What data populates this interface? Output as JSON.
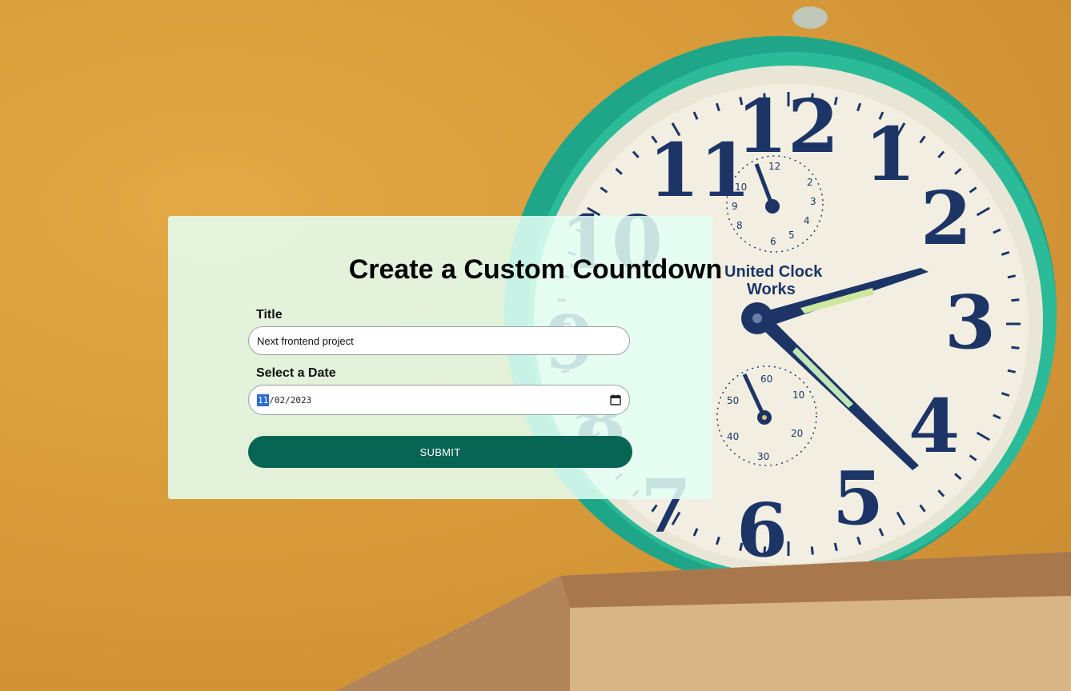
{
  "form": {
    "heading": "Create a Custom Countdown",
    "title_label": "Title",
    "title_value": "Next frontend project",
    "date_label": "Select a Date",
    "date_month": "11",
    "date_rest": "/02/2023",
    "date_icon": "calendar-icon",
    "submit_label": "SUBMIT"
  },
  "background": {
    "clock_brand_line1": "United Clock",
    "clock_brand_line2": "Works"
  },
  "colors": {
    "primary_button": "#076653",
    "card_background": "#e4fff5",
    "background_orange": "#d99b3a",
    "clock_case_green": "#1fa689",
    "clock_numerals": "#1d3566"
  }
}
